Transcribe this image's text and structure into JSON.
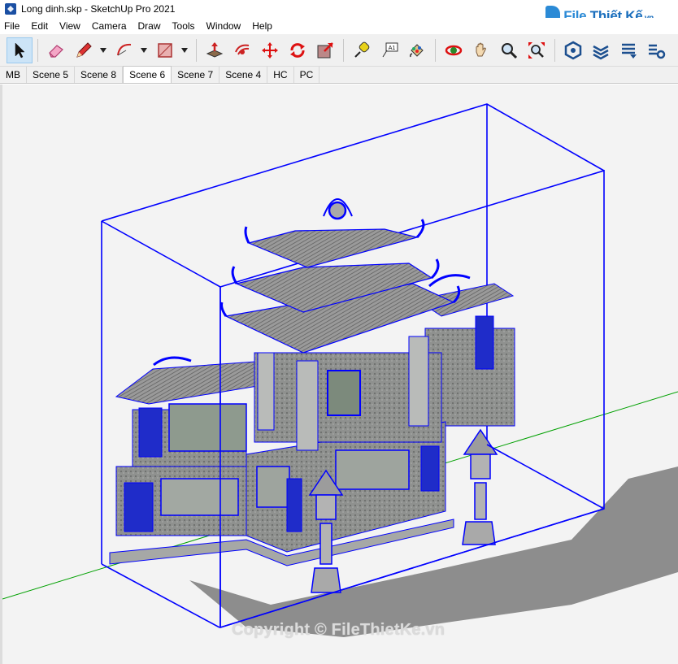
{
  "window": {
    "title": "Long dinh.skp - SketchUp Pro 2021"
  },
  "logo": {
    "text_file": "File",
    "text_thiet_ke": "Thiết Kế",
    "text_vn": ".vn"
  },
  "menu": {
    "items": [
      "File",
      "Edit",
      "View",
      "Camera",
      "Draw",
      "Tools",
      "Window",
      "Help"
    ]
  },
  "toolbar": {
    "tools": [
      {
        "name": "select-icon",
        "active": true
      },
      {
        "name": "eraser-icon"
      },
      {
        "name": "pencil-icon"
      },
      {
        "name": "arc-icon"
      },
      {
        "name": "rectangle-icon"
      },
      {
        "name": "push-pull-icon"
      },
      {
        "name": "offset-icon"
      },
      {
        "name": "move-icon"
      },
      {
        "name": "rotate-icon"
      },
      {
        "name": "scale-icon"
      },
      {
        "name": "tape-measure-icon"
      },
      {
        "name": "text-label-icon"
      },
      {
        "name": "paint-bucket-icon"
      },
      {
        "name": "orbit-icon"
      },
      {
        "name": "pan-icon"
      },
      {
        "name": "zoom-icon"
      },
      {
        "name": "zoom-extents-icon"
      },
      {
        "name": "warehouse-icon"
      },
      {
        "name": "extension-warehouse-icon"
      },
      {
        "name": "layout-icon"
      },
      {
        "name": "extension-manager-icon"
      }
    ],
    "text_label_glyph": "A1"
  },
  "scenes": {
    "tabs": [
      "MB",
      "Scene 5",
      "Scene 8",
      "Scene 6",
      "Scene 7",
      "Scene 4",
      "HC",
      "PC"
    ],
    "active": "Scene 6"
  },
  "viewport": {
    "watermark": "Copyright © FileThietKe.vn",
    "selection_color": "#0000ff",
    "green_axis_color": "#00a000"
  }
}
